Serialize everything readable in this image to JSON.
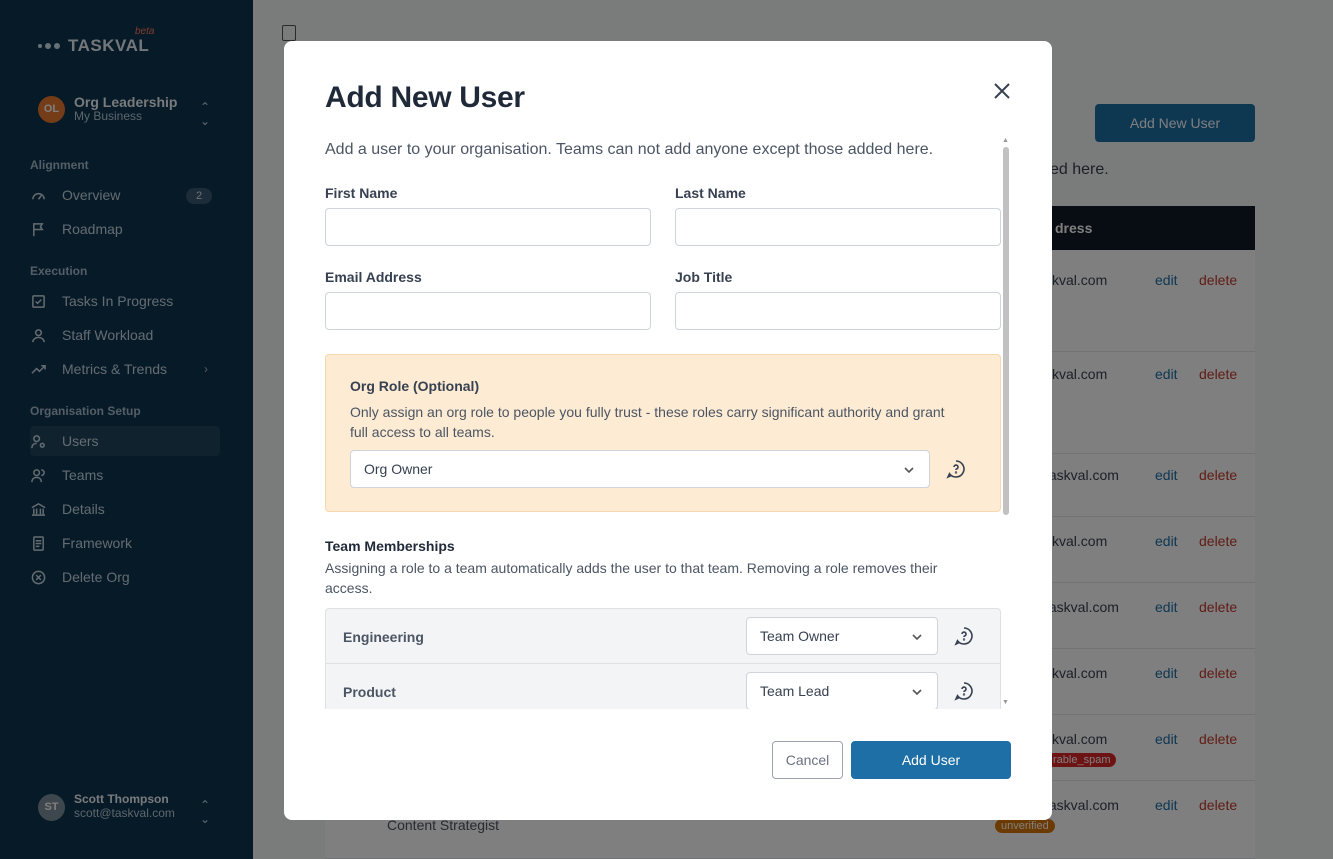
{
  "sidebar": {
    "logo_text": "TASKVAL",
    "beta_label": "beta",
    "org": {
      "initials": "OL",
      "name": "Org Leadership",
      "sub": "My Business"
    },
    "sections": {
      "alignment": "Alignment",
      "execution": "Execution",
      "setup": "Organisation Setup"
    },
    "items": {
      "overview": "Overview",
      "overview_badge": "2",
      "roadmap": "Roadmap",
      "tasks": "Tasks In Progress",
      "workload": "Staff Workload",
      "metrics": "Metrics & Trends",
      "users": "Users",
      "teams": "Teams",
      "details": "Details",
      "framework": "Framework",
      "delete_org": "Delete Org"
    },
    "user": {
      "initials": "ST",
      "name": "Scott Thompson",
      "email": "scott@taskval.com"
    }
  },
  "background": {
    "add_button": "Add New User",
    "note": "ed here.",
    "header_col": "dress",
    "rows": [
      {
        "email": "skval.com",
        "edit": "edit",
        "delete": "delete"
      },
      {
        "email": "skval.com",
        "edit": "edit",
        "delete": "delete"
      },
      {
        "email": "taskval.com",
        "edit": "edit",
        "delete": "delete"
      },
      {
        "email": "skval.com",
        "edit": "edit",
        "delete": "delete"
      },
      {
        "email": "taskval.com",
        "edit": "edit",
        "delete": "delete"
      },
      {
        "email": "skval.com",
        "edit": "edit",
        "delete": "delete"
      },
      {
        "email": "skval.com",
        "edit": "edit",
        "delete": "delete",
        "tag": "rable_spam"
      },
      {
        "email": "taskval.com",
        "edit": "edit",
        "delete": "delete",
        "tag": "unverified",
        "name": "Content Strategist"
      }
    ]
  },
  "modal": {
    "title": "Add New User",
    "description": "Add a user to your organisation. Teams can not add anyone except those added here.",
    "fields": {
      "first_name": {
        "label": "First Name",
        "value": ""
      },
      "last_name": {
        "label": "Last Name",
        "value": ""
      },
      "email": {
        "label": "Email Address",
        "value": ""
      },
      "job_title": {
        "label": "Job Title",
        "value": ""
      }
    },
    "org_role": {
      "title": "Org Role (Optional)",
      "description": "Only assign an org role to people you fully trust - these roles carry significant authority and grant full access to all teams.",
      "selected": "Org Owner"
    },
    "team_memberships": {
      "title": "Team Memberships",
      "description": "Assigning a role to a team automatically adds the user to that team. Removing a role removes their access.",
      "rows": [
        {
          "team": "Engineering",
          "role": "Team Owner"
        },
        {
          "team": "Product",
          "role": "Team Lead"
        }
      ]
    },
    "cancel_label": "Cancel",
    "submit_label": "Add User"
  },
  "colors": {
    "sidebar_bg": "#0f3550",
    "accent": "#1d6fa5",
    "warning_panel": "#fdebd3",
    "danger": "#c0392b"
  }
}
